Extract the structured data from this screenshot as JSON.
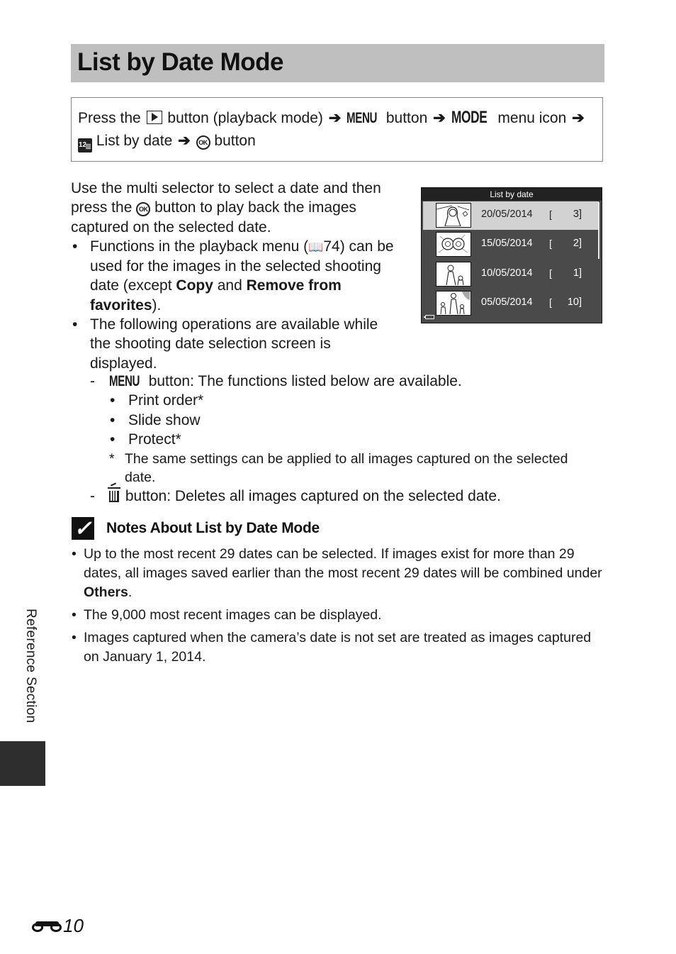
{
  "title": "List by Date Mode",
  "nav": {
    "press_the": "Press the",
    "playback_button_desc": "button (playback mode)",
    "menu_glyph": "MENU",
    "button_word": "button",
    "mode_glyph": "MODE",
    "menu_icon_text": "menu icon",
    "list_by_date": "List by date",
    "ok_glyph": "OK",
    "final_button": "button",
    "arrow": "➔",
    "cal_glyph": "12"
  },
  "intro": {
    "line_a": "Use the multi selector to select a date and then press the",
    "line_b": "button to play back the images captured on the selected date."
  },
  "bullets": [
    {
      "text_a": "Functions in the playback menu (",
      "ref_icon": "📖",
      "ref_page": "74) can be used for the images in the selected shooting date (except ",
      "bold1": "Copy",
      "mid": " and ",
      "bold2": "Remove from favorites",
      "end": ")."
    },
    {
      "text": "The following operations are available while the shooting date selection screen is displayed."
    }
  ],
  "operations": {
    "menu_item": {
      "glyph": "MENU",
      "text": "button: The functions listed below are available.",
      "functions": [
        "Print order*",
        "Slide show",
        "Protect*"
      ],
      "footnote": "The same settings can be applied to all images captured on the selected date."
    },
    "delete_item": {
      "text": "button: Deletes all images captured on the selected date."
    }
  },
  "camera_screen": {
    "header": "List by date",
    "rows": [
      {
        "date": "20/05/2014",
        "count": "3",
        "selected": true
      },
      {
        "date": "15/05/2014",
        "count": "2",
        "selected": false
      },
      {
        "date": "10/05/2014",
        "count": "1",
        "selected": false
      },
      {
        "date": "05/05/2014",
        "count": "10",
        "selected": false
      }
    ],
    "open_bracket": "[",
    "close_bracket": "]"
  },
  "notes": {
    "title": "Notes About List by Date Mode",
    "items": [
      {
        "text": "Up to the most recent 29 dates can be selected. If images exist for more than 29 dates, all images saved earlier than the most recent 29 dates will be combined under ",
        "bold": "Others",
        "end": "."
      },
      {
        "text": "The 9,000 most recent images can be displayed."
      },
      {
        "text": "Images captured when the camera’s date is not set are treated as images captured on January 1, 2014."
      }
    ]
  },
  "side_label": "Reference Section",
  "page_number": "10",
  "symbols": {
    "bullet": "•",
    "dash": "-",
    "asterisk": "*",
    "check": "✓"
  }
}
